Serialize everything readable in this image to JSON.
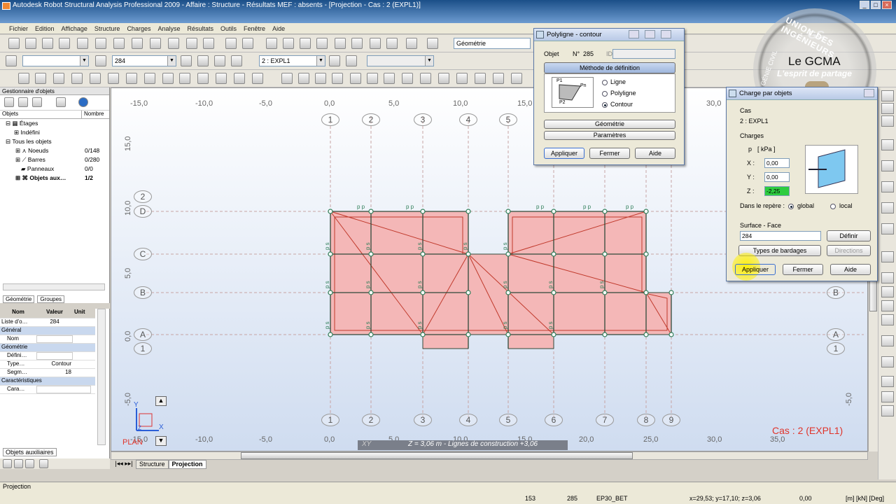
{
  "window": {
    "title": "Autodesk Robot Structural Analysis Professional 2009 - Affaire : Structure - Résultats MEF : absents - [Projection - Cas : 2 (EXPL1)]"
  },
  "menu": [
    "Fichier",
    "Edition",
    "Affichage",
    "Structure",
    "Charges",
    "Analyse",
    "Résultats",
    "Outils",
    "Fenêtre",
    "Aide"
  ],
  "toolbar": {
    "geometry_combo": "Géométrie",
    "object_combo": "284",
    "case_combo": "2 : EXPL1"
  },
  "object_manager": {
    "title": "Gestionnaire d'objets",
    "col_objets": "Objets",
    "col_nombre": "Nombre",
    "tree": [
      {
        "label": "Étages",
        "count": ""
      },
      {
        "label": "Indéfini",
        "count": ""
      },
      {
        "label": "Tous les objets",
        "count": ""
      },
      {
        "label": "Noeuds",
        "count": "0/148"
      },
      {
        "label": "Barres",
        "count": "0/280"
      },
      {
        "label": "Panneaux",
        "count": "0/0"
      },
      {
        "label": "Objets aux…",
        "count": "1/2"
      }
    ],
    "tabs": [
      "Géométrie",
      "Groupes"
    ]
  },
  "properties": {
    "headers": [
      "Nom",
      "Valeur",
      "Unit"
    ],
    "rows": [
      {
        "name": "Liste d'o…",
        "value": "284"
      },
      {
        "name": "Général",
        "value": ""
      },
      {
        "name": "Nom",
        "value": ""
      },
      {
        "name": "Géométrie",
        "value": ""
      },
      {
        "name": "Défini…",
        "value": ""
      },
      {
        "name": "Type…",
        "value": "Contour"
      },
      {
        "name": "Segm…",
        "value": "18"
      },
      {
        "name": "Caractéristiques",
        "value": ""
      },
      {
        "name": "Cara…",
        "value": ""
      }
    ],
    "bottom_tab": "Objets auxiliaires"
  },
  "viewport": {
    "x_ticks_top": [
      "-15,0",
      "-10,0",
      "-5,0",
      "0,0",
      "5,0",
      "10,0",
      "15,0",
      "30,0"
    ],
    "x_ticks_bottom": [
      "-15,0",
      "-10,0",
      "-5,0",
      "0,0",
      "5,0",
      "10,0",
      "15,0",
      "20,0",
      "25,0",
      "30,0",
      "35,0"
    ],
    "y_ticks_left": [
      "15,0",
      "10,0",
      "5,0",
      "0,0",
      "-5,0"
    ],
    "y_ticks_right": [
      "-5,0"
    ],
    "axis_x_labels": [
      "1",
      "2",
      "3",
      "4",
      "5",
      "6",
      "7",
      "8",
      "9"
    ],
    "axis_y_labels_left": [
      "2",
      "D",
      "C",
      "B",
      "A",
      "1"
    ],
    "axis_y_labels_right": [
      "B",
      "A",
      "1"
    ],
    "case_label": "Cas : 2 (EXPL1)",
    "plan_label": "PLAN",
    "coord_axes": [
      "Y",
      "X",
      "Z"
    ],
    "load_marker": "p",
    "load_marker_alt": "p s",
    "scroll_view": "XY",
    "scroll_status": "Z = 3,06 m - Lignes de construction +3,06",
    "bottom_tabs": [
      "Structure",
      "Projection"
    ]
  },
  "dialog_polyline": {
    "title": "Polyligne - contour",
    "objet_label": "Objet",
    "no_label": "N°",
    "no_value": "285",
    "id_label": "ID",
    "method_button": "Méthode de définition",
    "sketch_labels": [
      "P1",
      "Pn",
      "P2"
    ],
    "options": [
      "Ligne",
      "Polyligne",
      "Contour"
    ],
    "selected": "Contour",
    "geometry_button": "Géométrie",
    "params_button": "Paramètres",
    "apply": "Appliquer",
    "close": "Fermer",
    "help": "Aide"
  },
  "dialog_load": {
    "title": "Charge par objets",
    "cas_label": "Cas",
    "cas_value": "2 : EXPL1",
    "charges_label": "Charges",
    "p_label": "p",
    "unit_label": "[ kPa ]",
    "x_label": "X :",
    "x_value": "0,00",
    "y_label": "Y :",
    "y_value": "0,00",
    "z_label": "Z :",
    "z_value": "-2,25",
    "repere_label": "Dans le repère :",
    "global": "global",
    "local": "local",
    "surface_label": "Surface - Face",
    "surface_value": "284",
    "define_button": "Définir",
    "bardage_button": "Types de bardages",
    "directions_button": "Directions",
    "apply": "Appliquer",
    "close": "Fermer",
    "help": "Aide"
  },
  "watermark": {
    "line1": "Le GCMA",
    "line2": "L'esprit de partage",
    "ring_text": "UNION DES INGÉNIEURS",
    "gc": "GC",
    "left_text": "GÉNIE CIVIL"
  },
  "status": {
    "left": "Projection",
    "num1": "153",
    "num2": "285",
    "material": "EP30_BET",
    "coords": "x=29,53; y=17,10; z=3,06",
    "value": "0,00",
    "units": "[m] [kN] [Deg]"
  },
  "colors": {
    "slab_fill": "#f4b7b7",
    "slab_edge": "#c0392b",
    "node": "#2e7d57",
    "case_text": "#e0342a",
    "highlight": "#2ecc40"
  }
}
